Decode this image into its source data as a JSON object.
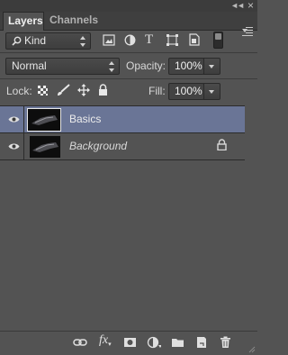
{
  "tabs": [
    {
      "label": "Layers",
      "active": true
    },
    {
      "label": "Channels",
      "active": false
    }
  ],
  "filter": {
    "kind_label": "Kind",
    "icons": [
      "image-filter-icon",
      "adjustment-filter-icon",
      "type-filter-icon",
      "shape-filter-icon",
      "smart-object-filter-icon",
      "filter-toggle-switch"
    ]
  },
  "blend": {
    "mode": "Normal",
    "opacity_label": "Opacity:",
    "opacity_value": "100%"
  },
  "lock": {
    "label": "Lock:",
    "fill_label": "Fill:",
    "fill_value": "100%",
    "icons": [
      "lock-transparent-pixels-icon",
      "lock-image-pixels-icon",
      "lock-position-icon",
      "lock-all-icon"
    ]
  },
  "layers": [
    {
      "name": "Basics",
      "visible": true,
      "selected": true,
      "locked": false
    },
    {
      "name": "Background",
      "visible": true,
      "selected": false,
      "locked": true
    }
  ],
  "footer_icons": [
    "link-layers-icon",
    "fx-icon",
    "layer-mask-icon",
    "adjustment-layer-icon",
    "new-group-icon",
    "new-layer-icon",
    "trash-icon"
  ],
  "colors": {
    "panel_bg": "#535353",
    "selected_row": "#6a7596"
  }
}
